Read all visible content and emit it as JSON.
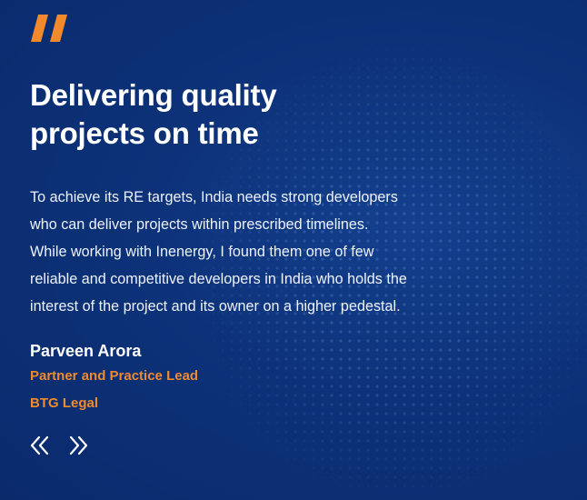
{
  "colors": {
    "background": "#0d3279",
    "accent_orange": "#f08a2d",
    "text_white": "#ffffff"
  },
  "icons": {
    "quote": "quote-icon",
    "prev": "chevron-double-left-icon",
    "next": "chevron-double-right-icon"
  },
  "testimonial": {
    "title_line1": "Delivering quality",
    "title_line2": "projects on time",
    "body_lines": [
      "To achieve its RE targets, India needs strong developers",
      "who can deliver projects within prescribed timelines.",
      "While working with Inenergy, I found them one of few",
      "reliable and competitive developers in India who holds the",
      "interest of the project and its owner on a higher pedestal."
    ],
    "author_name": "Parveen Arora",
    "author_role": "Partner and Practice Lead",
    "author_org": "BTG Legal"
  }
}
